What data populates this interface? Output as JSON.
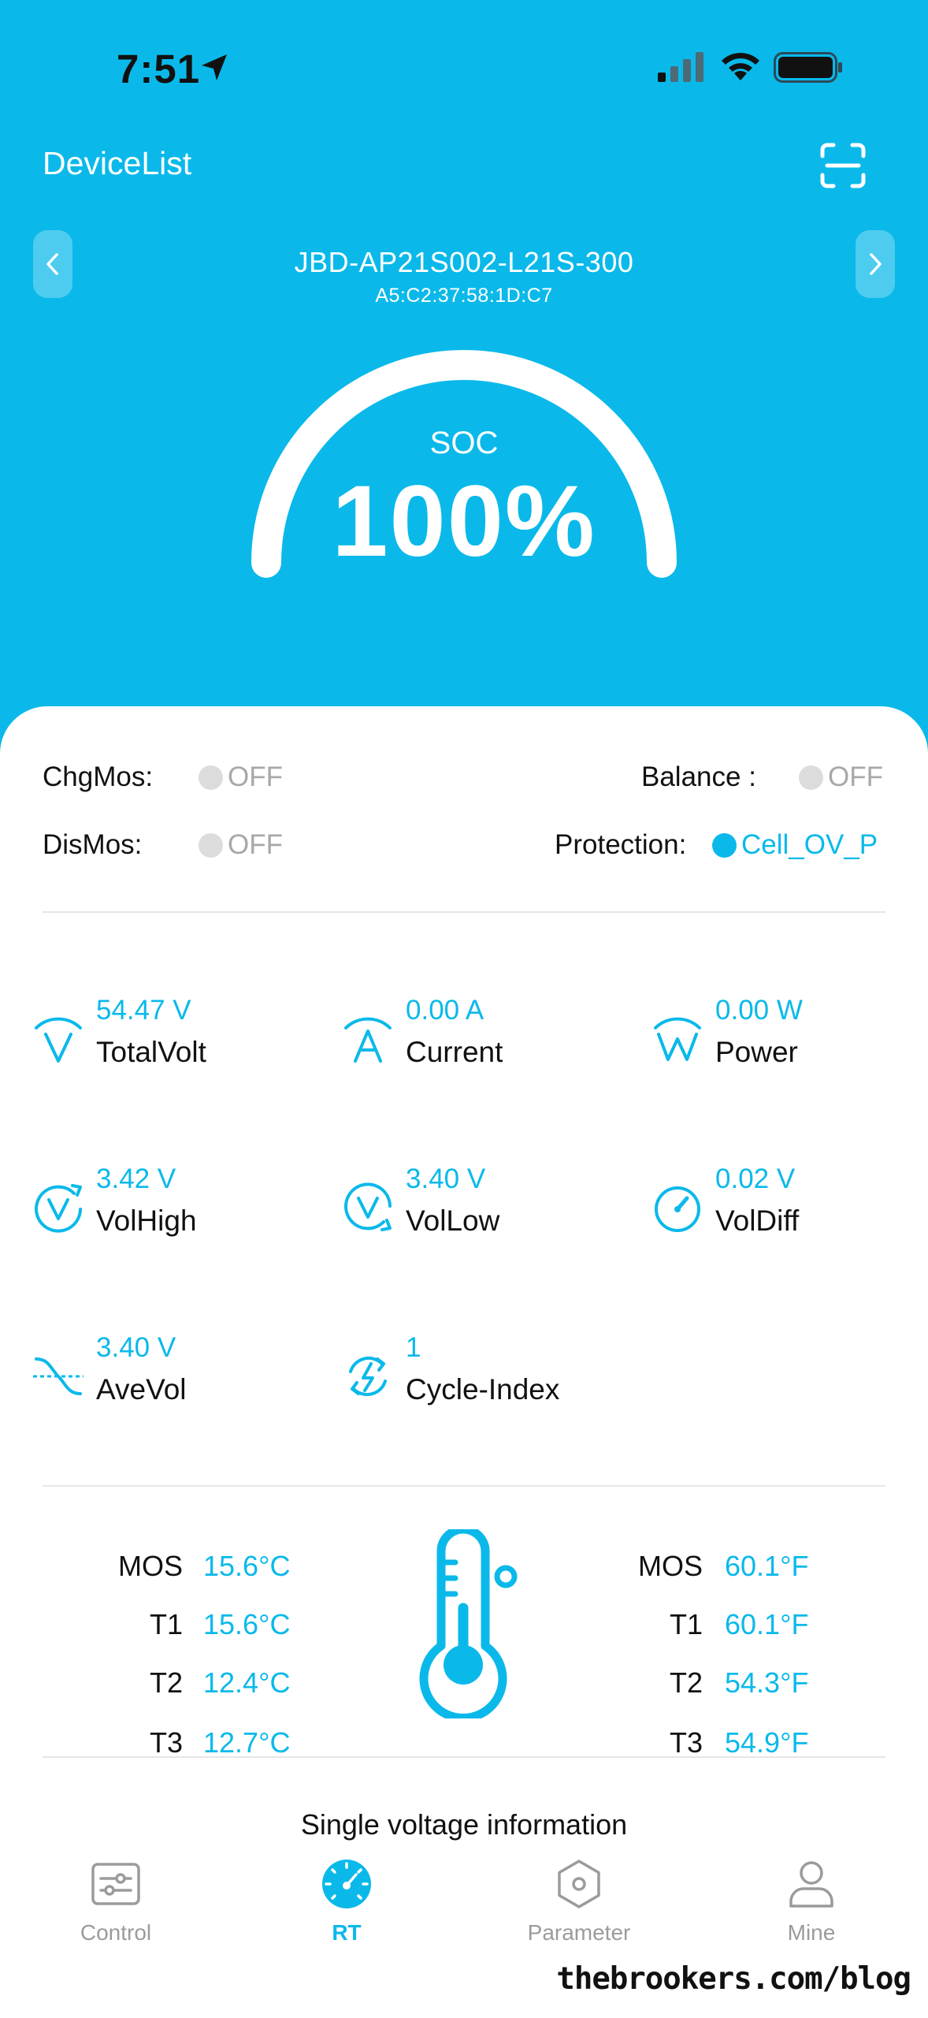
{
  "status_bar": {
    "time": "7:51"
  },
  "header": {
    "title": "DeviceList",
    "device_name": "JBD-AP21S002-L21S-300",
    "device_mac": "A5:C2:37:58:1D:C7",
    "soc_label": "SOC",
    "soc_value": "100%",
    "soc_level": 1.0
  },
  "status": {
    "chgmos": {
      "label": "ChgMos:",
      "value": "OFF"
    },
    "dismos": {
      "label": "DisMos:",
      "value": "OFF"
    },
    "balance": {
      "label": "Balance :",
      "value": "OFF"
    },
    "protection": {
      "label": "Protection:",
      "value": "Cell_OV_P"
    }
  },
  "metrics": [
    {
      "name": "TotalVolt",
      "value": "54.47 V",
      "icon": "volt-arc-icon"
    },
    {
      "name": "Current",
      "value": "0.00 A",
      "icon": "amp-arc-icon"
    },
    {
      "name": "Power",
      "value": "0.00 W",
      "icon": "watt-arc-icon"
    },
    {
      "name": "VolHigh",
      "value": "3.42 V",
      "icon": "volt-high-icon"
    },
    {
      "name": "VolLow",
      "value": "3.40 V",
      "icon": "volt-low-icon"
    },
    {
      "name": "VolDiff",
      "value": "0.02 V",
      "icon": "gauge-icon"
    },
    {
      "name": "AveVol",
      "value": "3.40 V",
      "icon": "average-wave-icon"
    },
    {
      "name": "Cycle-Index",
      "value": "1",
      "icon": "cycle-bolt-icon"
    }
  ],
  "temperatures": {
    "celsius": [
      {
        "label": "MOS",
        "value": "15.6°C"
      },
      {
        "label": "T1",
        "value": "15.6°C"
      },
      {
        "label": "T2",
        "value": "12.4°C"
      },
      {
        "label": "T3",
        "value": "12.7°C"
      }
    ],
    "fahrenheit": [
      {
        "label": "MOS",
        "value": "60.1°F"
      },
      {
        "label": "T1",
        "value": "60.1°F"
      },
      {
        "label": "T2",
        "value": "54.3°F"
      },
      {
        "label": "T3",
        "value": "54.9°F"
      }
    ]
  },
  "section_title": "Single voltage information",
  "tabs": [
    {
      "label": "Control",
      "icon": "sliders-icon",
      "active": false
    },
    {
      "label": "RT",
      "icon": "speedometer-icon",
      "active": true
    },
    {
      "label": "Parameter",
      "icon": "hex-nut-icon",
      "active": false
    },
    {
      "label": "Mine",
      "icon": "person-icon",
      "active": false
    }
  ],
  "watermark": "thebrookers.com/blog",
  "colors": {
    "accent": "#0ab9ea",
    "off_dot": "#dcdcdc",
    "text": "#111111"
  }
}
